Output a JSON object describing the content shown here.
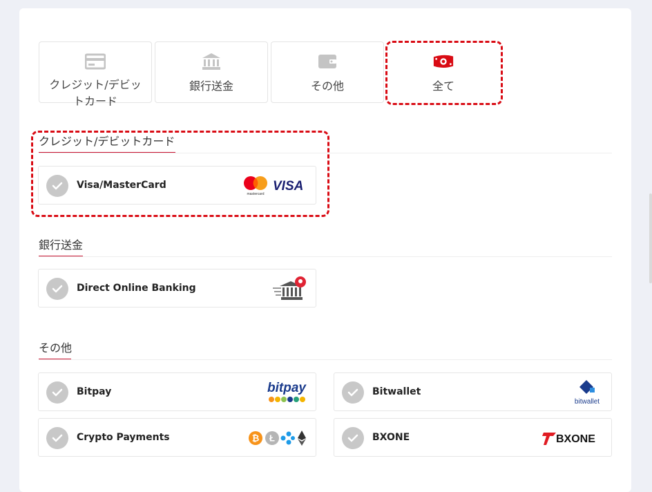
{
  "tabs": [
    {
      "label": "クレジット/デビットカード",
      "icon": "credit-card-icon"
    },
    {
      "label": "銀行送金",
      "icon": "bank-icon"
    },
    {
      "label": "その他",
      "icon": "wallet-icon"
    },
    {
      "label": "全て",
      "icon": "banknote-icon"
    }
  ],
  "sections": {
    "card": {
      "title": "クレジット/デビットカード",
      "options": [
        {
          "label": "Visa/MasterCard",
          "logo": "visa-mastercard-logo",
          "mastercard_text": "mastercard",
          "visa_text": "VISA"
        }
      ]
    },
    "bank": {
      "title": "銀行送金",
      "options": [
        {
          "label": "Direct Online Banking",
          "logo": "bank-transfer-logo"
        }
      ]
    },
    "other": {
      "title": "その他",
      "options": [
        {
          "label": "Bitpay",
          "logo": "bitpay-logo",
          "logo_text": "bitpay"
        },
        {
          "label": "Bitwallet",
          "logo": "bitwallet-logo",
          "logo_text": "bitwallet"
        },
        {
          "label": "Crypto Payments",
          "logo": "crypto-logos"
        },
        {
          "label": "BXONE",
          "logo": "bxone-logo",
          "logo_text": "BXONE"
        }
      ]
    }
  },
  "colors": {
    "accent": "#c8102e",
    "highlight": "#d90b14",
    "check": "#c8c8c8",
    "tab_icon": "#c4c4c4"
  }
}
